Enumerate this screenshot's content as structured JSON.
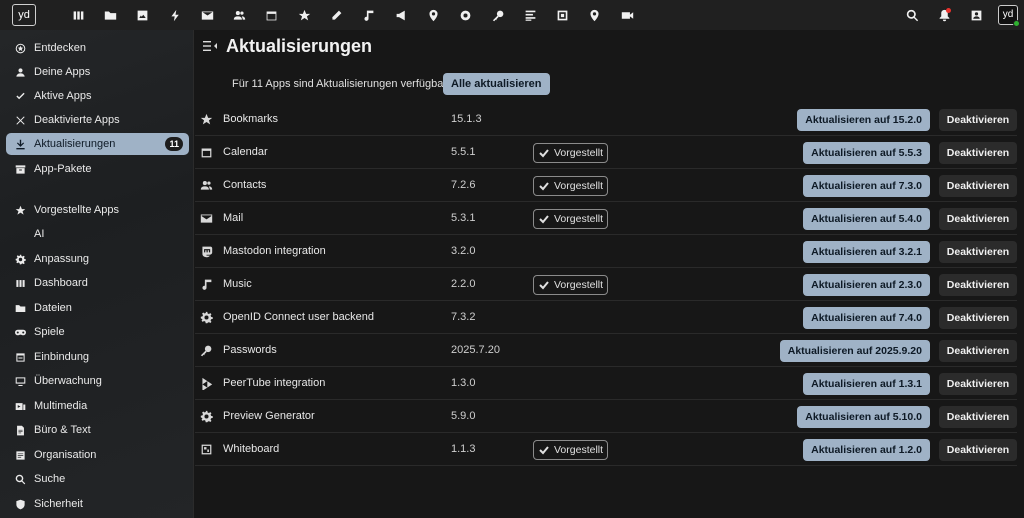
{
  "topbar": {
    "logo_text": "yd",
    "apps": [
      {
        "icon": "dashboard-icon"
      },
      {
        "icon": "files-icon"
      },
      {
        "icon": "photos-icon"
      },
      {
        "icon": "activity-icon"
      },
      {
        "icon": "mail-icon"
      },
      {
        "icon": "contacts-icon"
      },
      {
        "icon": "calendar-icon"
      },
      {
        "icon": "bookmarks-icon"
      },
      {
        "icon": "notes-icon"
      },
      {
        "icon": "music-icon"
      },
      {
        "icon": "announcements-icon"
      },
      {
        "icon": "maps-icon"
      },
      {
        "icon": "radio-icon"
      },
      {
        "icon": "passwords-icon"
      },
      {
        "icon": "tasks-icon"
      },
      {
        "icon": "whiteboard-icon"
      },
      {
        "icon": "location-icon"
      },
      {
        "icon": "talk-icon"
      }
    ],
    "right_icons": [
      "search-icon",
      "notifications-icon",
      "contacts-menu-icon"
    ],
    "avatar_text": "yd"
  },
  "sidebar": {
    "items": [
      {
        "label": "Entdecken",
        "icon": "star-circle-icon"
      },
      {
        "label": "Deine Apps",
        "icon": "account-icon"
      },
      {
        "label": "Aktive Apps",
        "icon": "check-icon"
      },
      {
        "label": "Deaktivierte Apps",
        "icon": "close-icon"
      },
      {
        "label": "Aktualisierungen",
        "icon": "download-icon",
        "count": "11",
        "active": true
      },
      {
        "label": "App-Pakete",
        "icon": "archive-icon"
      },
      {
        "label": "Vorgestellte Apps",
        "icon": "star-icon"
      },
      {
        "label": "AI",
        "icon": ""
      },
      {
        "label": "Anpassung",
        "icon": "cog-icon"
      },
      {
        "label": "Dashboard",
        "icon": "view-column-icon"
      },
      {
        "label": "Dateien",
        "icon": "folder-icon"
      },
      {
        "label": "Spiele",
        "icon": "gamepad-icon"
      },
      {
        "label": "Einbindung",
        "icon": "link-box-icon"
      },
      {
        "label": "Überwachung",
        "icon": "monitor-icon"
      },
      {
        "label": "Multimedia",
        "icon": "multimedia-icon"
      },
      {
        "label": "Büro & Text",
        "icon": "office-icon"
      },
      {
        "label": "Organisation",
        "icon": "organisation-icon"
      },
      {
        "label": "Suche",
        "icon": "search-icon"
      },
      {
        "label": "Sicherheit",
        "icon": "shield-icon"
      }
    ]
  },
  "main": {
    "title": "Aktualisierungen",
    "info": "Für 11 Apps sind Aktualisierungen verfügbar.",
    "update_all_label": "Alle aktualisieren",
    "apps": [
      {
        "name": "Bookmarks",
        "version": "15.1.3",
        "featured": false,
        "update_label": "Aktualisieren auf 15.2.0",
        "disable_label": "Deaktivieren",
        "icon": "star-icon"
      },
      {
        "name": "Calendar",
        "version": "5.5.1",
        "featured": true,
        "update_label": "Aktualisieren auf 5.5.3",
        "disable_label": "Deaktivieren",
        "icon": "calendar-icon"
      },
      {
        "name": "Contacts",
        "version": "7.2.6",
        "featured": true,
        "update_label": "Aktualisieren auf 7.3.0",
        "disable_label": "Deaktivieren",
        "icon": "contacts-icon"
      },
      {
        "name": "Mail",
        "version": "5.3.1",
        "featured": true,
        "update_label": "Aktualisieren auf 5.4.0",
        "disable_label": "Deaktivieren",
        "icon": "mail-icon"
      },
      {
        "name": "Mastodon integration",
        "version": "3.2.0",
        "featured": false,
        "update_label": "Aktualisieren auf 3.2.1",
        "disable_label": "Deaktivieren",
        "icon": "mastodon-icon"
      },
      {
        "name": "Music",
        "version": "2.2.0",
        "featured": true,
        "update_label": "Aktualisieren auf 2.3.0",
        "disable_label": "Deaktivieren",
        "icon": "music-icon"
      },
      {
        "name": "OpenID Connect user backend",
        "version": "7.3.2",
        "featured": false,
        "update_label": "Aktualisieren auf 7.4.0",
        "disable_label": "Deaktivieren",
        "icon": "cog-icon"
      },
      {
        "name": "Passwords",
        "version": "2025.7.20",
        "featured": false,
        "update_label": "Aktualisieren auf 2025.9.20",
        "disable_label": "Deaktivieren",
        "icon": "key-icon"
      },
      {
        "name": "PeerTube integration",
        "version": "1.3.0",
        "featured": false,
        "update_label": "Aktualisieren auf 1.3.1",
        "disable_label": "Deaktivieren",
        "icon": "peertube-icon"
      },
      {
        "name": "Preview Generator",
        "version": "5.9.0",
        "featured": false,
        "update_label": "Aktualisieren auf 5.10.0",
        "disable_label": "Deaktivieren",
        "icon": "cog-icon"
      },
      {
        "name": "Whiteboard",
        "version": "1.1.3",
        "featured": true,
        "update_label": "Aktualisieren auf 1.2.0",
        "disable_label": "Deaktivieren",
        "icon": "whiteboard-icon"
      }
    ],
    "featured_label": "Vorgestellt"
  }
}
